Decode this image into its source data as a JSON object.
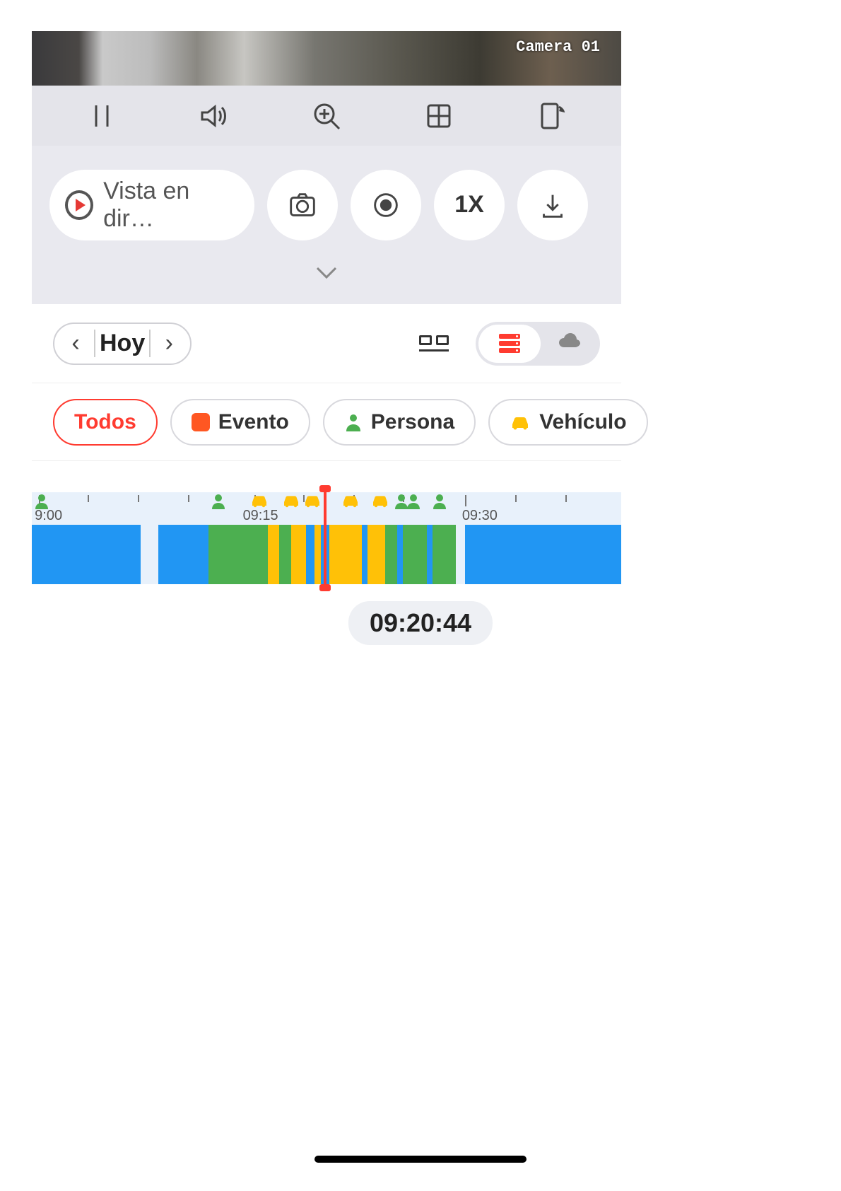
{
  "camera": {
    "overlay_label": "Camera 01"
  },
  "toolbar": {
    "pause": "pause",
    "sound": "sound",
    "zoom": "zoom-in",
    "grid": "grid",
    "rotate": "rotate-device"
  },
  "actions": {
    "live_label": "Vista en dir…",
    "snapshot": "snapshot",
    "record": "record",
    "speed_label": "1X",
    "download": "download"
  },
  "date_nav": {
    "label": "Hoy"
  },
  "storage": {
    "active": "local"
  },
  "filters": {
    "all": "Todos",
    "event": "Evento",
    "person": "Persona",
    "vehicle": "Vehículo"
  },
  "timeline": {
    "labels": {
      "t0": "9:00",
      "t1": "09:15",
      "t2": "09:30"
    },
    "current_time": "09:20:44",
    "icons": [
      {
        "type": "person",
        "pos": 0.5
      },
      {
        "type": "person",
        "pos": 30.5
      },
      {
        "type": "car",
        "pos": 37
      },
      {
        "type": "car",
        "pos": 42.5
      },
      {
        "type": "car",
        "pos": 46
      },
      {
        "type": "car",
        "pos": 52.5
      },
      {
        "type": "car",
        "pos": 57.5
      },
      {
        "type": "person",
        "pos": 61.5
      },
      {
        "type": "person",
        "pos": 63.5
      },
      {
        "type": "person",
        "pos": 68
      }
    ],
    "segments": [
      {
        "color": "blue",
        "start": 0,
        "end": 18.5
      },
      {
        "color": "blue",
        "start": 21.5,
        "end": 30
      },
      {
        "color": "green",
        "start": 30,
        "end": 40
      },
      {
        "color": "yellow",
        "start": 40,
        "end": 42
      },
      {
        "color": "green",
        "start": 42,
        "end": 44
      },
      {
        "color": "yellow",
        "start": 44,
        "end": 46.5
      },
      {
        "color": "blue",
        "start": 46.5,
        "end": 48
      },
      {
        "color": "yellow",
        "start": 48,
        "end": 49
      },
      {
        "color": "blue",
        "start": 49,
        "end": 50.5
      },
      {
        "color": "yellow",
        "start": 50.5,
        "end": 56
      },
      {
        "color": "blue",
        "start": 56,
        "end": 57
      },
      {
        "color": "yellow",
        "start": 57,
        "end": 60
      },
      {
        "color": "green",
        "start": 60,
        "end": 62
      },
      {
        "color": "blue",
        "start": 62,
        "end": 63
      },
      {
        "color": "green",
        "start": 63,
        "end": 67
      },
      {
        "color": "blue",
        "start": 67,
        "end": 68
      },
      {
        "color": "green",
        "start": 68,
        "end": 72
      },
      {
        "color": "blue",
        "start": 73.5,
        "end": 100
      }
    ],
    "playhead_pct": 49.5
  }
}
